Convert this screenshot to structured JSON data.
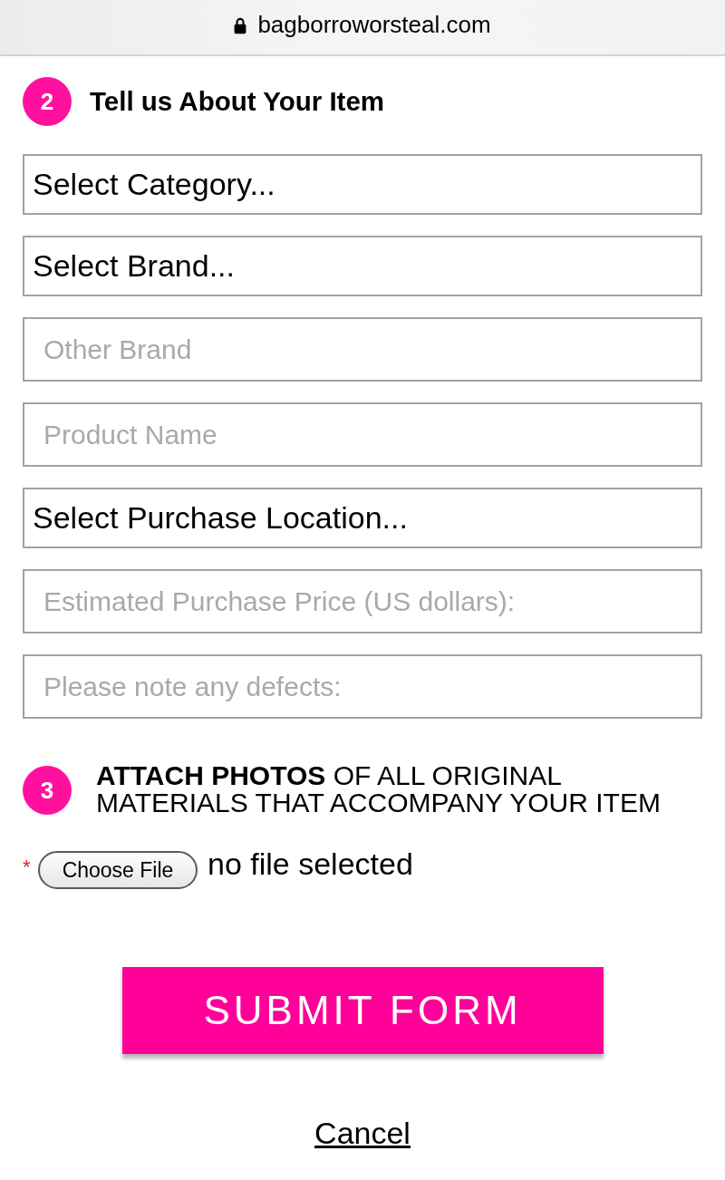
{
  "address_bar": {
    "secure": true,
    "url": "bagborroworsteal.com"
  },
  "item_section": {
    "number": "2",
    "title": "Tell us About Your Item"
  },
  "fields": [
    {
      "kind": "select",
      "value": "Select Category..."
    },
    {
      "kind": "select",
      "value": "Select Brand..."
    },
    {
      "kind": "input",
      "placeholder": "Other Brand"
    },
    {
      "kind": "input",
      "placeholder": "Product Name"
    },
    {
      "kind": "select",
      "value": "Select Purchase Location..."
    },
    {
      "kind": "input",
      "placeholder": "Estimated Purchase Price (US dollars):"
    },
    {
      "kind": "input",
      "placeholder": "Please note any defects:"
    }
  ],
  "photo_section": {
    "number": "3",
    "text": "**ATTACH PHOTOS** OF ALL ORIGINAL MATERIALS THAT ACCOMPANY YOUR ITEM"
  },
  "file_upload": {
    "required_mark": "*",
    "button": "Choose File",
    "status": "no file selected"
  },
  "submit_button": "SUBMIT FORM",
  "cancel_link": "Cancel"
}
